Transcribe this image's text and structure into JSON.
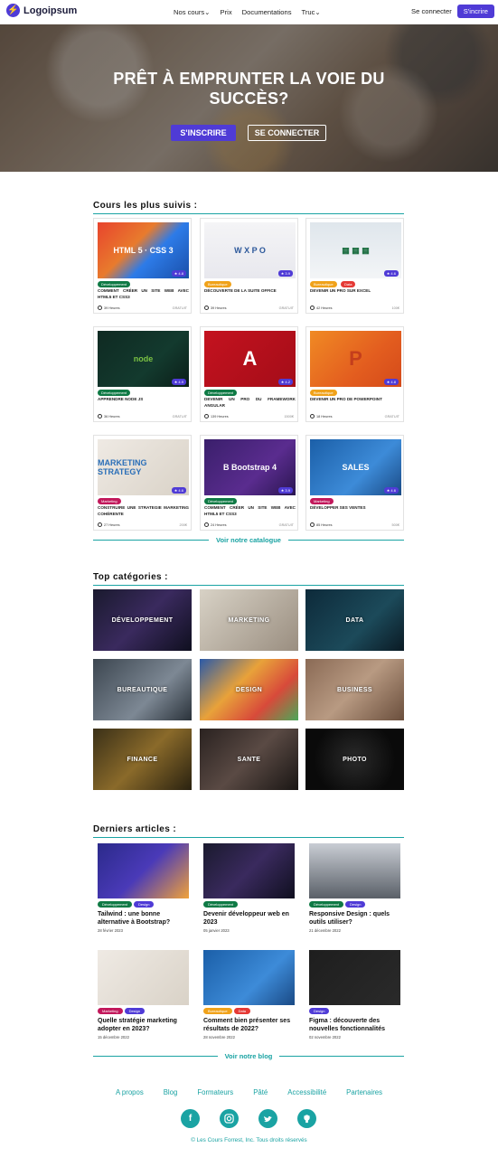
{
  "nav": {
    "logo": "Logoipsum",
    "links": [
      "Nos cours⌄",
      "Prix",
      "Documentations",
      "Truc⌄"
    ],
    "login": "Se connecter",
    "signup": "S'incrire"
  },
  "hero": {
    "title_line1": "PRÊT À EMPRUNTER LA VOIE DU",
    "title_line2": "SUCCÈS?",
    "primary": "S'INSCRIRE",
    "secondary": "SE CONNECTER"
  },
  "courses": {
    "title": "Cours les plus suivis :",
    "items": [
      {
        "tag": "Développement",
        "tag_color": "#0f7a45",
        "title": "COMMENT CRÉER UN SITE WEB AVEC HTML5 ET CSS3",
        "hours": "39 Heures",
        "price": "GRATUIT",
        "rating": "★ 4.8"
      },
      {
        "tag": "Bureautique",
        "tag_color": "#f0a21a",
        "title": "DÉCOUVERTE DE LA SUITE OFFICE",
        "hours": "39 Heures",
        "price": "GRATUIT",
        "rating": "★ 3.9"
      },
      {
        "tag": "Bureautique",
        "tag_color": "#f0a21a",
        "tag2": "Data",
        "tag2_color": "#e53935",
        "title": "DEVENIR UN PRO SUR EXCEL",
        "hours": "42 Heures",
        "price": "100€",
        "rating": "★ 4.6"
      },
      {
        "tag": "Développement",
        "tag_color": "#0f7a45",
        "title": "APPRENDRE NODE JS",
        "hours": "36 Heures",
        "price": "GRATUIT",
        "rating": "★ 4.9"
      },
      {
        "tag": "Développement",
        "tag_color": "#0f7a45",
        "title": "DEVENIR UN PRO DU FRAMEWORK ANGULAR",
        "hours": "139 Heures",
        "price": "1500€",
        "rating": "★ 4.2"
      },
      {
        "tag": "Bureautique",
        "tag_color": "#f0a21a",
        "title": "DEVENIR UN PRO DE POWERPOINT",
        "hours": "18 Heures",
        "price": "GRATUIT",
        "rating": "★ 4.8"
      },
      {
        "tag": "Marketing",
        "tag_color": "#c2185b",
        "title": "CONSTRUIRE UNE STRATEGIE MARKETING COHÉRENTE",
        "hours": "27 Heures",
        "price": "200€",
        "rating": "★ 4.6"
      },
      {
        "tag": "Développement",
        "tag_color": "#0f7a45",
        "title": "COMMENT CRÉER UN SITE WEB AVEC HTML5 ET CSS3",
        "hours": "24 Heures",
        "price": "GRATUIT",
        "rating": "★ 3.9"
      },
      {
        "tag": "Marketing",
        "tag_color": "#c2185b",
        "title": "DÉVELOPPER SES VENTES",
        "hours": "85 Heures",
        "price": "500€",
        "rating": "★ 4.6"
      }
    ],
    "catalog_link": "Voir notre catalogue"
  },
  "categories": {
    "title": "Top catégories :",
    "items": [
      "DÉVELOPPEMENT",
      "MARKETING",
      "DATA",
      "BUREAUTIQUE",
      "DESIGN",
      "BUSINESS",
      "FINANCE",
      "SANTE",
      "PHOTO"
    ]
  },
  "articles": {
    "title": "Derniers articles :",
    "items": [
      {
        "tags": [
          {
            "label": "Développement",
            "color": "#0f7a45"
          },
          {
            "label": "Design",
            "color": "#4f3bd6"
          }
        ],
        "title": "Tailwind : une bonne alternative à Bootstrap?",
        "date": "28 février 2023"
      },
      {
        "tags": [
          {
            "label": "Développement",
            "color": "#0f7a45"
          }
        ],
        "title": "Devenir développeur web en 2023",
        "date": "05 janvier 2023"
      },
      {
        "tags": [
          {
            "label": "Développement",
            "color": "#0f7a45"
          },
          {
            "label": "Design",
            "color": "#4f3bd6"
          }
        ],
        "title": "Responsive Design : quels outils utiliser?",
        "date": "21 décembre 2022"
      },
      {
        "tags": [
          {
            "label": "Marketing",
            "color": "#c2185b"
          },
          {
            "label": "Design",
            "color": "#4f3bd6"
          }
        ],
        "title": "Quelle stratégie marketing adopter en 2023?",
        "date": "15 décembre 2022"
      },
      {
        "tags": [
          {
            "label": "Bureautique",
            "color": "#f0a21a"
          },
          {
            "label": "Data",
            "color": "#e53935"
          }
        ],
        "title": "Comment bien présenter ses résultats de 2022?",
        "date": "28 novembre 2022"
      },
      {
        "tags": [
          {
            "label": "Design",
            "color": "#4f3bd6"
          }
        ],
        "title": "Figma : découverte des nouvelles fonctionnalités",
        "date": "02 novembre 2022"
      }
    ],
    "blog_link": "Voir notre blog"
  },
  "footer": {
    "links": [
      "A propos",
      "Blog",
      "Formateurs",
      "Pâté",
      "Accessibilité",
      "Partenaires"
    ],
    "social": [
      "facebook-icon",
      "instagram-icon",
      "twitter-icon",
      "github-icon"
    ],
    "copyright": "© Les Cours Forrest, Inc. Tous droits réservés"
  }
}
